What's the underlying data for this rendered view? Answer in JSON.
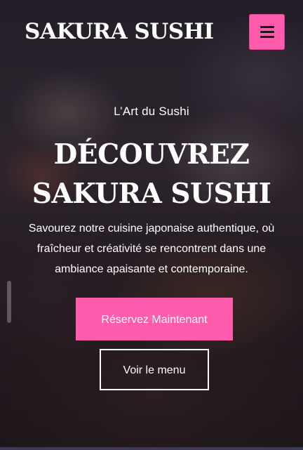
{
  "brand": {
    "name": "SAKURA SUSHI"
  },
  "header": {
    "menu_icon": "hamburger-menu-icon"
  },
  "hero": {
    "kicker": "L’Art du Sushi",
    "headline_line1": "DÉCOUVREZ",
    "headline_line2": "SAKURA SUSHI",
    "description": "Savourez notre cuisine japonaise authentique, où fraîcheur et créativité se rencontrent dans une ambiance apaisante et contemporaine.",
    "primary_button": "Réservez Maintenant",
    "secondary_button": "Voir le menu"
  },
  "colors": {
    "accent": "#ff5cae",
    "text": "#ffffff",
    "overlay": "#1c1620"
  }
}
